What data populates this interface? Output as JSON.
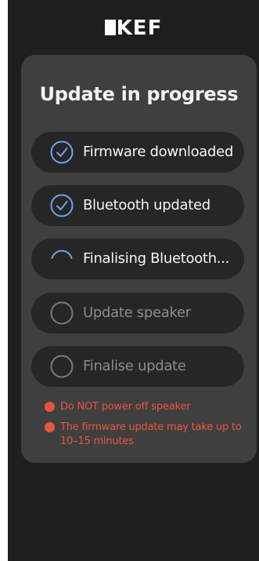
{
  "header": {
    "brand": "KEF"
  },
  "update": {
    "title": "Update in progress",
    "steps": [
      {
        "label": "Firmware downloaded",
        "status": "done"
      },
      {
        "label": "Bluetooth updated",
        "status": "done"
      },
      {
        "label": "Finalising Bluetooth...",
        "status": "in-progress"
      },
      {
        "label": "Update speaker",
        "status": "pending"
      },
      {
        "label": "Finalise update",
        "status": "pending"
      }
    ],
    "warnings": [
      "Do NOT power off speaker",
      "The firmware update may take up to 10–15 minutes"
    ]
  },
  "colors": {
    "background": "#1e1e1e",
    "card": "#3f3f3f",
    "step_pill": "#262626",
    "accent_blue": "#6ea3ea",
    "warning_red": "#e8553f",
    "pending_text": "#8c8c8c"
  },
  "icons": {
    "done": "check-circle-icon",
    "in_progress": "spinner-icon",
    "pending": "empty-circle-icon",
    "warning": "warning-dot-icon"
  }
}
